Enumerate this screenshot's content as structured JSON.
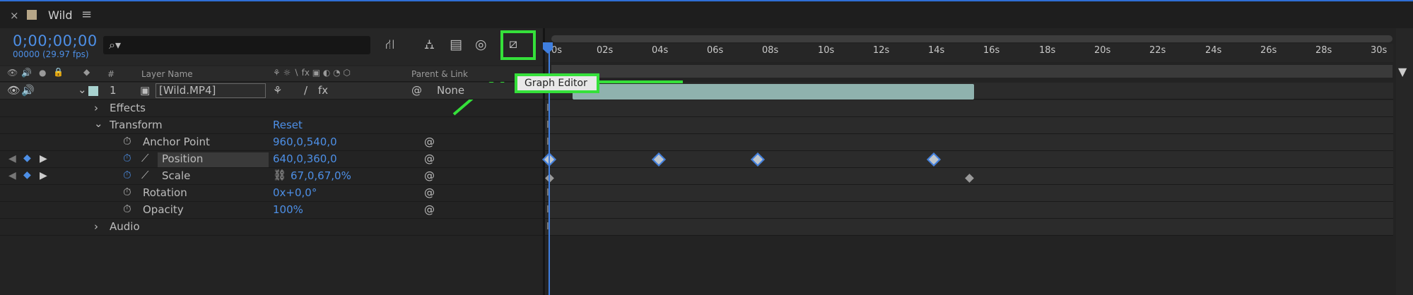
{
  "tab": {
    "close": "×",
    "title": "Wild",
    "menu": "≡"
  },
  "timecode": "0;00;00;00",
  "fps": "00000 (29.97 fps)",
  "search": {
    "icon": "⌕▾",
    "value": ""
  },
  "columns": {
    "hash": "#",
    "layer_name": "Layer Name",
    "parent_link": "Parent & Link",
    "switches": "⚘ ☼ ∖ fx ▣ ◐ ◔ ⬡"
  },
  "layer": {
    "number": "1",
    "name": "[Wild.MP4]",
    "parent": "None"
  },
  "properties": [
    {
      "label": "Effects",
      "value": ""
    },
    {
      "label": "Transform",
      "value": "Reset"
    },
    {
      "label": "Anchor Point",
      "value": "960,0,540,0"
    },
    {
      "label": "Position",
      "value": "640,0,360,0"
    },
    {
      "label": "Scale",
      "value": "67,0,67,0%"
    },
    {
      "label": "Rotation",
      "value": "0x+0,0°"
    },
    {
      "label": "Opacity",
      "value": "100%"
    },
    {
      "label": "Audio",
      "value": ""
    }
  ],
  "ruler": [
    "0s",
    "02s",
    "04s",
    "06s",
    "08s",
    "10s",
    "12s",
    "14s",
    "16s",
    "18s",
    "20s",
    "22s",
    "24s",
    "26s",
    "28s",
    "30s"
  ],
  "tooltip": "Graph Editor",
  "colors": {
    "accent": "#4d8fe6",
    "highlight": "#35e03a",
    "layer_bar": "#8fb2ae"
  }
}
